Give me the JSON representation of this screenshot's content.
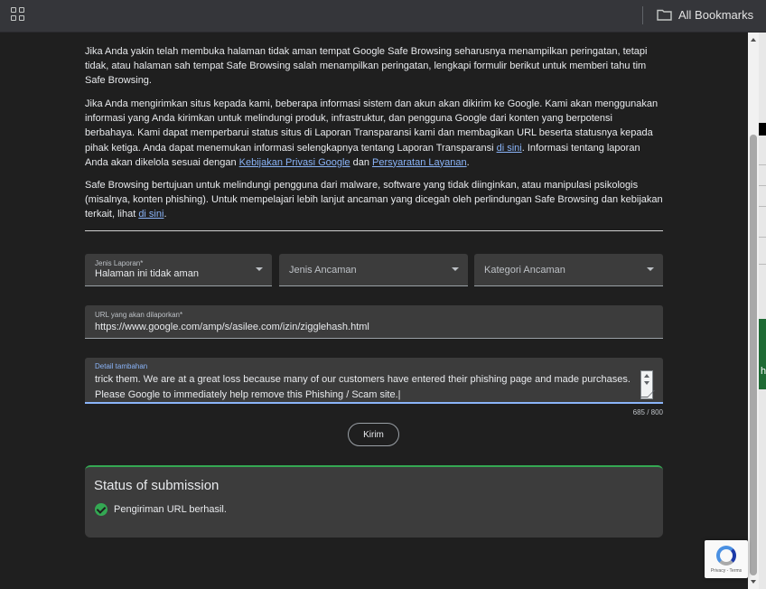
{
  "bookmarks_bar": {
    "all_bookmarks_label": "All Bookmarks"
  },
  "content": {
    "paragraph_1": "Jika Anda yakin telah membuka halaman tidak aman tempat Google Safe Browsing seharusnya menampilkan peringatan, tetapi tidak, atau halaman sah tempat Safe Browsing salah menampilkan peringatan, lengkapi formulir berikut untuk memberi tahu tim Safe Browsing.",
    "paragraph_2": {
      "text_a": "Jika Anda mengirimkan situs kepada kami, beberapa informasi sistem dan akun akan dikirim ke Google. Kami akan menggunakan informasi yang Anda kirimkan untuk melindungi produk, infrastruktur, dan pengguna Google dari konten yang berpotensi berbahaya. Kami dapat memperbarui status situs di Laporan Transparansi kami dan membagikan URL beserta statusnya kepada pihak ketiga. Anda dapat menemukan informasi selengkapnya tentang Laporan Transparansi ",
      "link_1": "di sini",
      "text_b": ". Informasi tentang laporan Anda akan dikelola sesuai dengan ",
      "link_2": "Kebijakan Privasi Google",
      "text_c": " dan ",
      "link_3": "Persyaratan Layanan",
      "text_d": "."
    },
    "paragraph_3": {
      "text_a": "Safe Browsing bertujuan untuk melindungi pengguna dari malware, software yang tidak diinginkan, atau manipulasi psikologis (misalnya, konten phishing). Untuk mempelajari lebih lanjut ancaman yang dicegah oleh perlindungan Safe Browsing dan kebijakan terkait, lihat ",
      "link": "di sini",
      "text_b": "."
    }
  },
  "form": {
    "report_type": {
      "label": "Jenis Laporan*",
      "value": "Halaman ini tidak aman"
    },
    "threat_type": {
      "placeholder": "Jenis Ancaman"
    },
    "threat_category": {
      "placeholder": "Kategori Ancaman"
    },
    "url": {
      "label": "URL yang akan dilaporkan*",
      "value": "https://www.google.com/amp/s/asilee.com/izin/zigglehash.html"
    },
    "details": {
      "label": "Detail tambahan",
      "value": "trick them. We are at a great loss because many of our customers have entered their phishing page and made purchases.\nPlease Google to immediately help remove this Phishing / Scam site.|"
    },
    "char_counter": "685 / 800",
    "submit_label": "Kirim"
  },
  "status": {
    "title": "Status of submission",
    "message": "Pengiriman URL berhasil."
  },
  "recaptcha": {
    "text": "Privacy - Terms"
  },
  "underlying_page": {
    "partial_letter": "h"
  },
  "colors": {
    "link": "#8ab4f8",
    "success": "#34a853",
    "field_bg": "#3c3c3c",
    "page_bg": "#1f1f1f"
  }
}
